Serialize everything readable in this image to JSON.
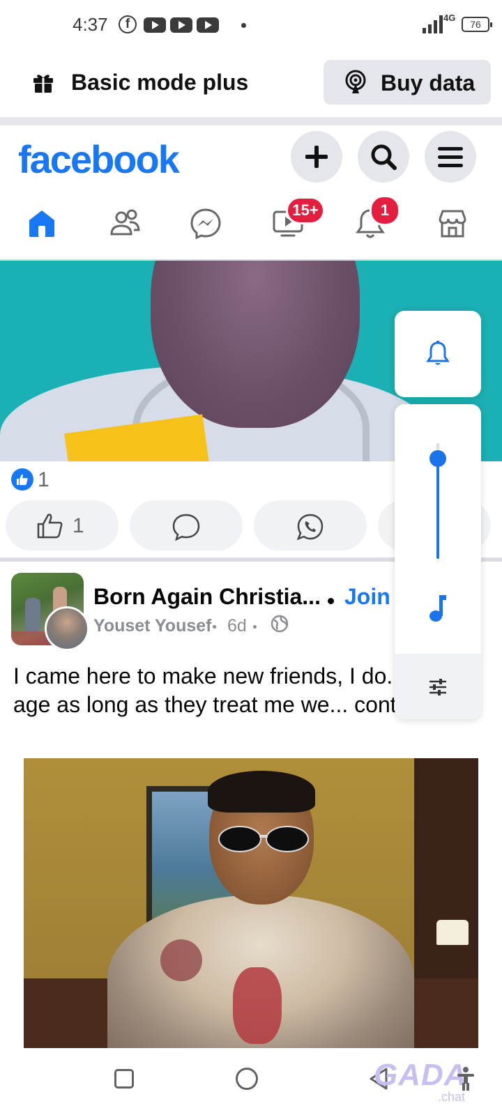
{
  "status_bar": {
    "time": "4:37",
    "network": "4G",
    "battery": "76"
  },
  "basic_bar": {
    "mode_label": "Basic mode plus",
    "buy_data_label": "Buy data"
  },
  "header": {
    "logo": "facebook"
  },
  "tabs": {
    "video_badge": "15+",
    "notifications_badge": "1"
  },
  "post1": {
    "reaction_count": "1",
    "like_count": "1"
  },
  "post2": {
    "group_name": "Born Again Christia...",
    "join_label": "Join",
    "author": "Youset Yousef",
    "time": "6d",
    "text": "I came here to make new friends, I do... about age as long as they treat me we... contact"
  },
  "watermark": {
    "text": "GADA",
    "sub": ".chat"
  },
  "colors": {
    "brand": "#1877f2",
    "badge": "#e41e3f",
    "volume_accent": "#1a73e8"
  },
  "icons": [
    "gift-icon",
    "buy-data-icon",
    "plus-icon",
    "search-icon",
    "menu-icon",
    "home-icon",
    "friends-icon",
    "messenger-icon",
    "video-icon",
    "bell-icon",
    "marketplace-icon",
    "like-icon",
    "comment-icon",
    "whatsapp-icon",
    "globe-icon",
    "music-note-icon",
    "equalizer-icon",
    "recents-icon",
    "home-nav-icon",
    "back-icon",
    "accessibility-icon"
  ]
}
